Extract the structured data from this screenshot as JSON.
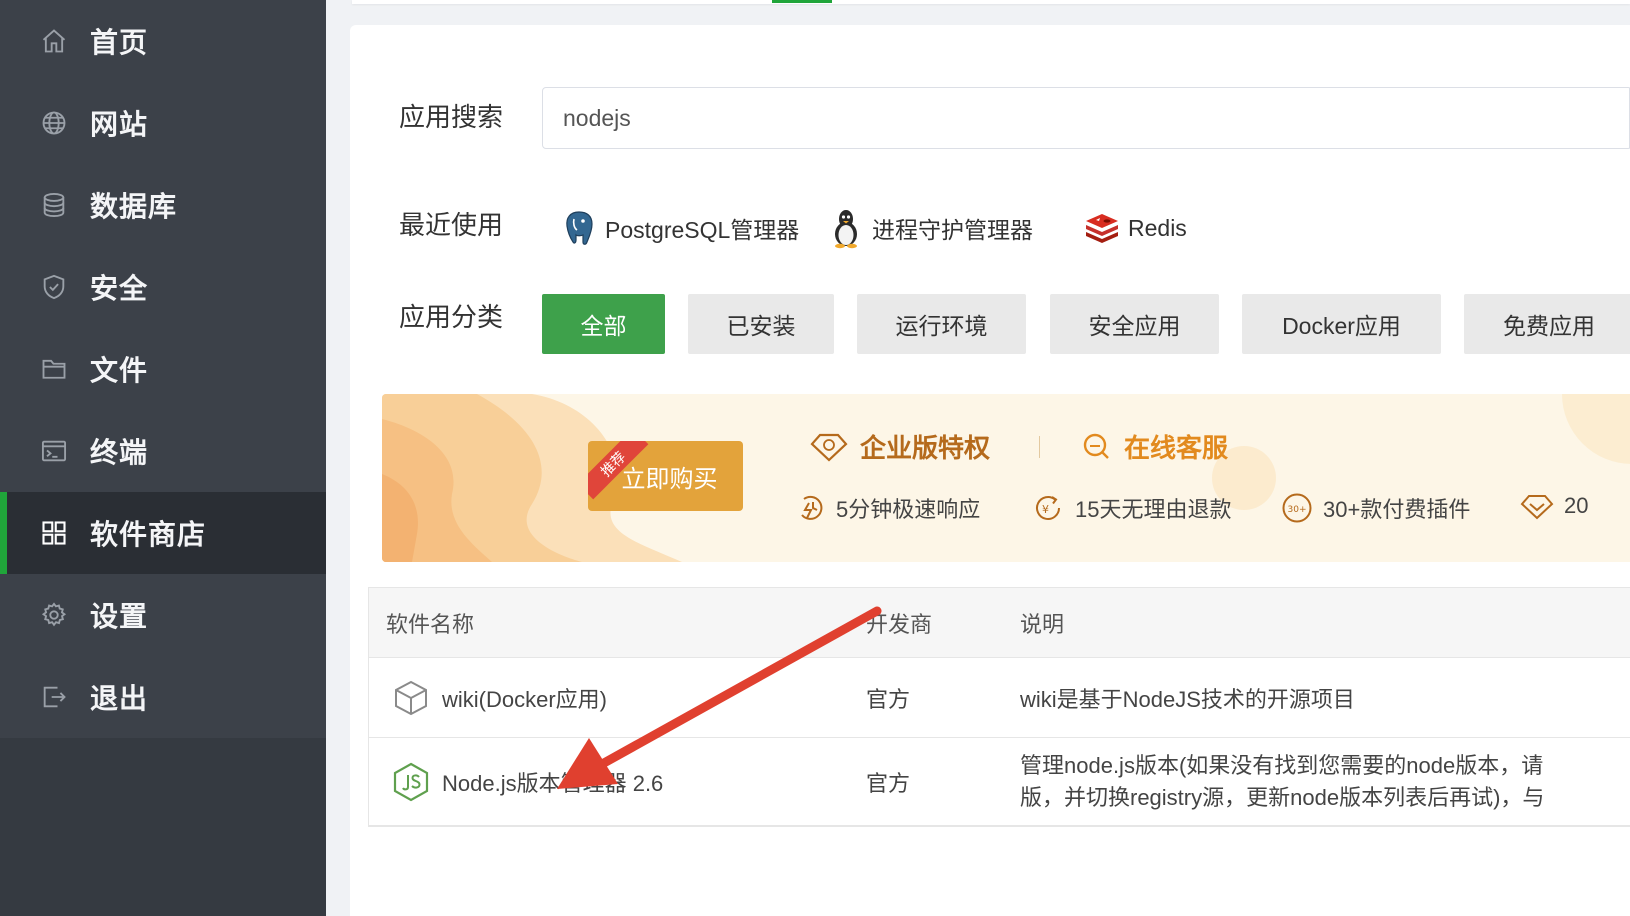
{
  "sidebar": {
    "items": [
      {
        "label": "首页",
        "icon": "home-icon",
        "active": false
      },
      {
        "label": "网站",
        "icon": "globe-icon",
        "active": false
      },
      {
        "label": "数据库",
        "icon": "database-icon",
        "active": false
      },
      {
        "label": "安全",
        "icon": "shield-icon",
        "active": false
      },
      {
        "label": "文件",
        "icon": "folder-icon",
        "active": false
      },
      {
        "label": "终端",
        "icon": "terminal-icon",
        "active": false
      },
      {
        "label": "软件商店",
        "icon": "grid-icon",
        "active": true
      },
      {
        "label": "设置",
        "icon": "gear-icon",
        "active": false
      },
      {
        "label": "退出",
        "icon": "logout-icon",
        "active": false
      }
    ]
  },
  "search": {
    "label": "应用搜索",
    "value": "nodejs"
  },
  "recent": {
    "label": "最近使用",
    "items": [
      {
        "label": "PostgreSQL管理器",
        "icon": "postgresql-icon"
      },
      {
        "label": "进程守护管理器",
        "icon": "penguin-icon"
      },
      {
        "label": "Redis",
        "icon": "redis-icon"
      }
    ]
  },
  "categories": {
    "label": "应用分类",
    "items": [
      {
        "label": "全部",
        "active": true
      },
      {
        "label": "已安装",
        "active": false
      },
      {
        "label": "运行环境",
        "active": false
      },
      {
        "label": "安全应用",
        "active": false
      },
      {
        "label": "Docker应用",
        "active": false
      },
      {
        "label": "免费应用",
        "active": false
      }
    ]
  },
  "banner": {
    "ribbon": "推荐",
    "buy_label": "立即购买",
    "enterprise_title": "企业版特权",
    "service_title": "在线客服",
    "perks": [
      "5分钟极速响应",
      "15天无理由退款",
      "30+款付费插件",
      "20"
    ],
    "perk_badge": "30+"
  },
  "table": {
    "headers": {
      "name": "软件名称",
      "vendor": "开发商",
      "desc": "说明"
    },
    "rows": [
      {
        "name": "wiki(Docker应用)",
        "vendor": "官方",
        "desc1": "wiki是基于NodeJS技术的开源项目",
        "desc2": "",
        "icon": "cube-icon"
      },
      {
        "name": "Node.js版本管理器 2.6",
        "vendor": "官方",
        "desc1": "管理node.js版本(如果没有找到您需要的node版本，请",
        "desc2": "版，并切换registry源，更新node版本列表后再试)，与",
        "icon": "nodejs-icon"
      }
    ]
  },
  "colors": {
    "accent": "#20a53a",
    "sidebar_bg": "#3c4149",
    "banner_bg": "#fdf6e7",
    "buy_button": "#e3a33b",
    "annotation_arrow": "#e0402f"
  }
}
